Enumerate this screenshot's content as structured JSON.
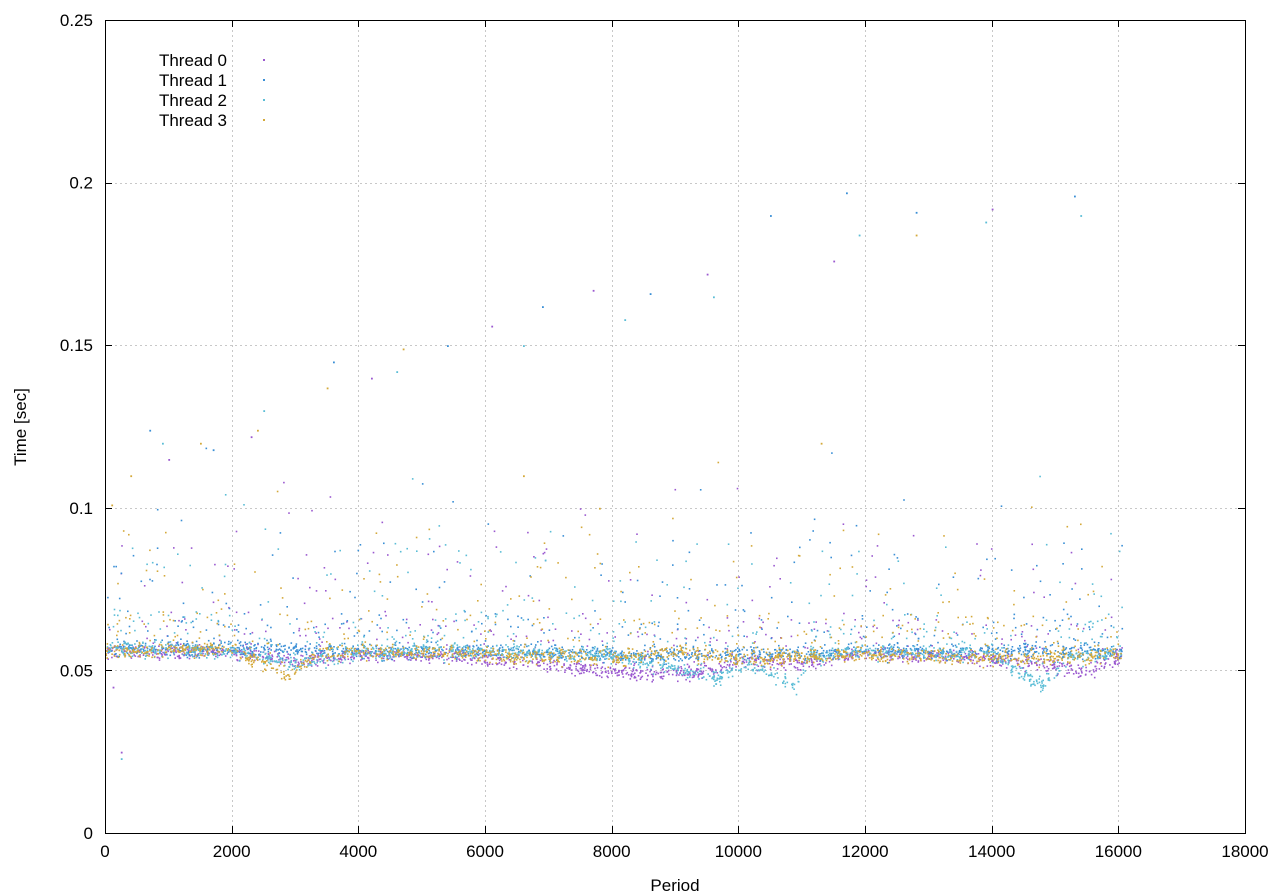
{
  "chart_data": {
    "type": "scatter",
    "title": "",
    "xlabel": "Period",
    "ylabel": "Time [sec]",
    "xlim": [
      0,
      18000
    ],
    "ylim": [
      0,
      0.25
    ],
    "x_ticks": [
      0,
      2000,
      4000,
      6000,
      8000,
      10000,
      12000,
      14000,
      16000,
      18000
    ],
    "x_tick_labels": [
      "0",
      "2000",
      "4000",
      "6000",
      "8000",
      "10000",
      "12000",
      "14000",
      "16000",
      "18000"
    ],
    "y_ticks": [
      0,
      0.05,
      0.1,
      0.15,
      0.2,
      0.25
    ],
    "y_tick_labels": [
      "0",
      "0.05",
      "0.1",
      "0.15",
      "0.2",
      "0.25"
    ],
    "grid": true,
    "legend_position": "top-left",
    "series": [
      {
        "name": "Thread 0",
        "color": "#9b59d0",
        "x_range": [
          0,
          16050
        ],
        "baseline": [
          [
            0,
            0.056
          ],
          [
            2000,
            0.056
          ],
          [
            3000,
            0.053
          ],
          [
            4000,
            0.055
          ],
          [
            6000,
            0.054
          ],
          [
            8500,
            0.049
          ],
          [
            9600,
            0.05
          ],
          [
            10000,
            0.053
          ],
          [
            11000,
            0.052
          ],
          [
            12000,
            0.055
          ],
          [
            14000,
            0.054
          ],
          [
            15500,
            0.05
          ],
          [
            16050,
            0.055
          ]
        ],
        "outliers": [
          [
            120,
            0.045
          ],
          [
            250,
            0.025
          ],
          [
            1000,
            0.115
          ],
          [
            2300,
            0.122
          ],
          [
            4200,
            0.14
          ],
          [
            6100,
            0.156
          ],
          [
            7700,
            0.167
          ],
          [
            9500,
            0.172
          ],
          [
            11500,
            0.176
          ],
          [
            14000,
            0.192
          ]
        ]
      },
      {
        "name": "Thread 1",
        "color": "#3a8fd6",
        "x_range": [
          0,
          16050
        ],
        "baseline": [
          [
            0,
            0.057
          ],
          [
            2000,
            0.057
          ],
          [
            4000,
            0.056
          ],
          [
            6000,
            0.056
          ],
          [
            8000,
            0.055
          ],
          [
            10000,
            0.055
          ],
          [
            12000,
            0.056
          ],
          [
            14000,
            0.056
          ],
          [
            16050,
            0.056
          ]
        ],
        "outliers": [
          [
            700,
            0.124
          ],
          [
            1700,
            0.118
          ],
          [
            3600,
            0.145
          ],
          [
            5400,
            0.15
          ],
          [
            6900,
            0.162
          ],
          [
            8600,
            0.166
          ],
          [
            10500,
            0.19
          ],
          [
            11700,
            0.197
          ],
          [
            12800,
            0.191
          ],
          [
            15300,
            0.196
          ]
        ]
      },
      {
        "name": "Thread 2",
        "color": "#5bbdd6",
        "x_range": [
          0,
          16050
        ],
        "baseline": [
          [
            0,
            0.057
          ],
          [
            2000,
            0.056
          ],
          [
            3000,
            0.052
          ],
          [
            4000,
            0.056
          ],
          [
            6000,
            0.056
          ],
          [
            8000,
            0.055
          ],
          [
            9600,
            0.048
          ],
          [
            10200,
            0.052
          ],
          [
            10900,
            0.045
          ],
          [
            11100,
            0.054
          ],
          [
            12000,
            0.056
          ],
          [
            14000,
            0.055
          ],
          [
            14800,
            0.045
          ],
          [
            15200,
            0.054
          ],
          [
            16050,
            0.056
          ]
        ],
        "outliers": [
          [
            250,
            0.023
          ],
          [
            900,
            0.12
          ],
          [
            2500,
            0.13
          ],
          [
            4600,
            0.142
          ],
          [
            6600,
            0.15
          ],
          [
            8200,
            0.158
          ],
          [
            9600,
            0.165
          ],
          [
            11900,
            0.184
          ],
          [
            13900,
            0.188
          ],
          [
            15400,
            0.19
          ]
        ]
      },
      {
        "name": "Thread 3",
        "color": "#d4a93a",
        "x_range": [
          0,
          16050
        ],
        "baseline": [
          [
            0,
            0.056
          ],
          [
            2000,
            0.057
          ],
          [
            2900,
            0.048
          ],
          [
            3300,
            0.055
          ],
          [
            4000,
            0.056
          ],
          [
            6000,
            0.055
          ],
          [
            8000,
            0.054
          ],
          [
            9000,
            0.056
          ],
          [
            10000,
            0.054
          ],
          [
            12000,
            0.055
          ],
          [
            14000,
            0.054
          ],
          [
            16050,
            0.055
          ]
        ],
        "outliers": [
          [
            100,
            0.101
          ],
          [
            400,
            0.11
          ],
          [
            1500,
            0.12
          ],
          [
            2400,
            0.124
          ],
          [
            3500,
            0.137
          ],
          [
            4700,
            0.149
          ],
          [
            6600,
            0.11
          ],
          [
            7800,
            0.1
          ],
          [
            11300,
            0.12
          ],
          [
            12800,
            0.184
          ]
        ]
      }
    ]
  }
}
